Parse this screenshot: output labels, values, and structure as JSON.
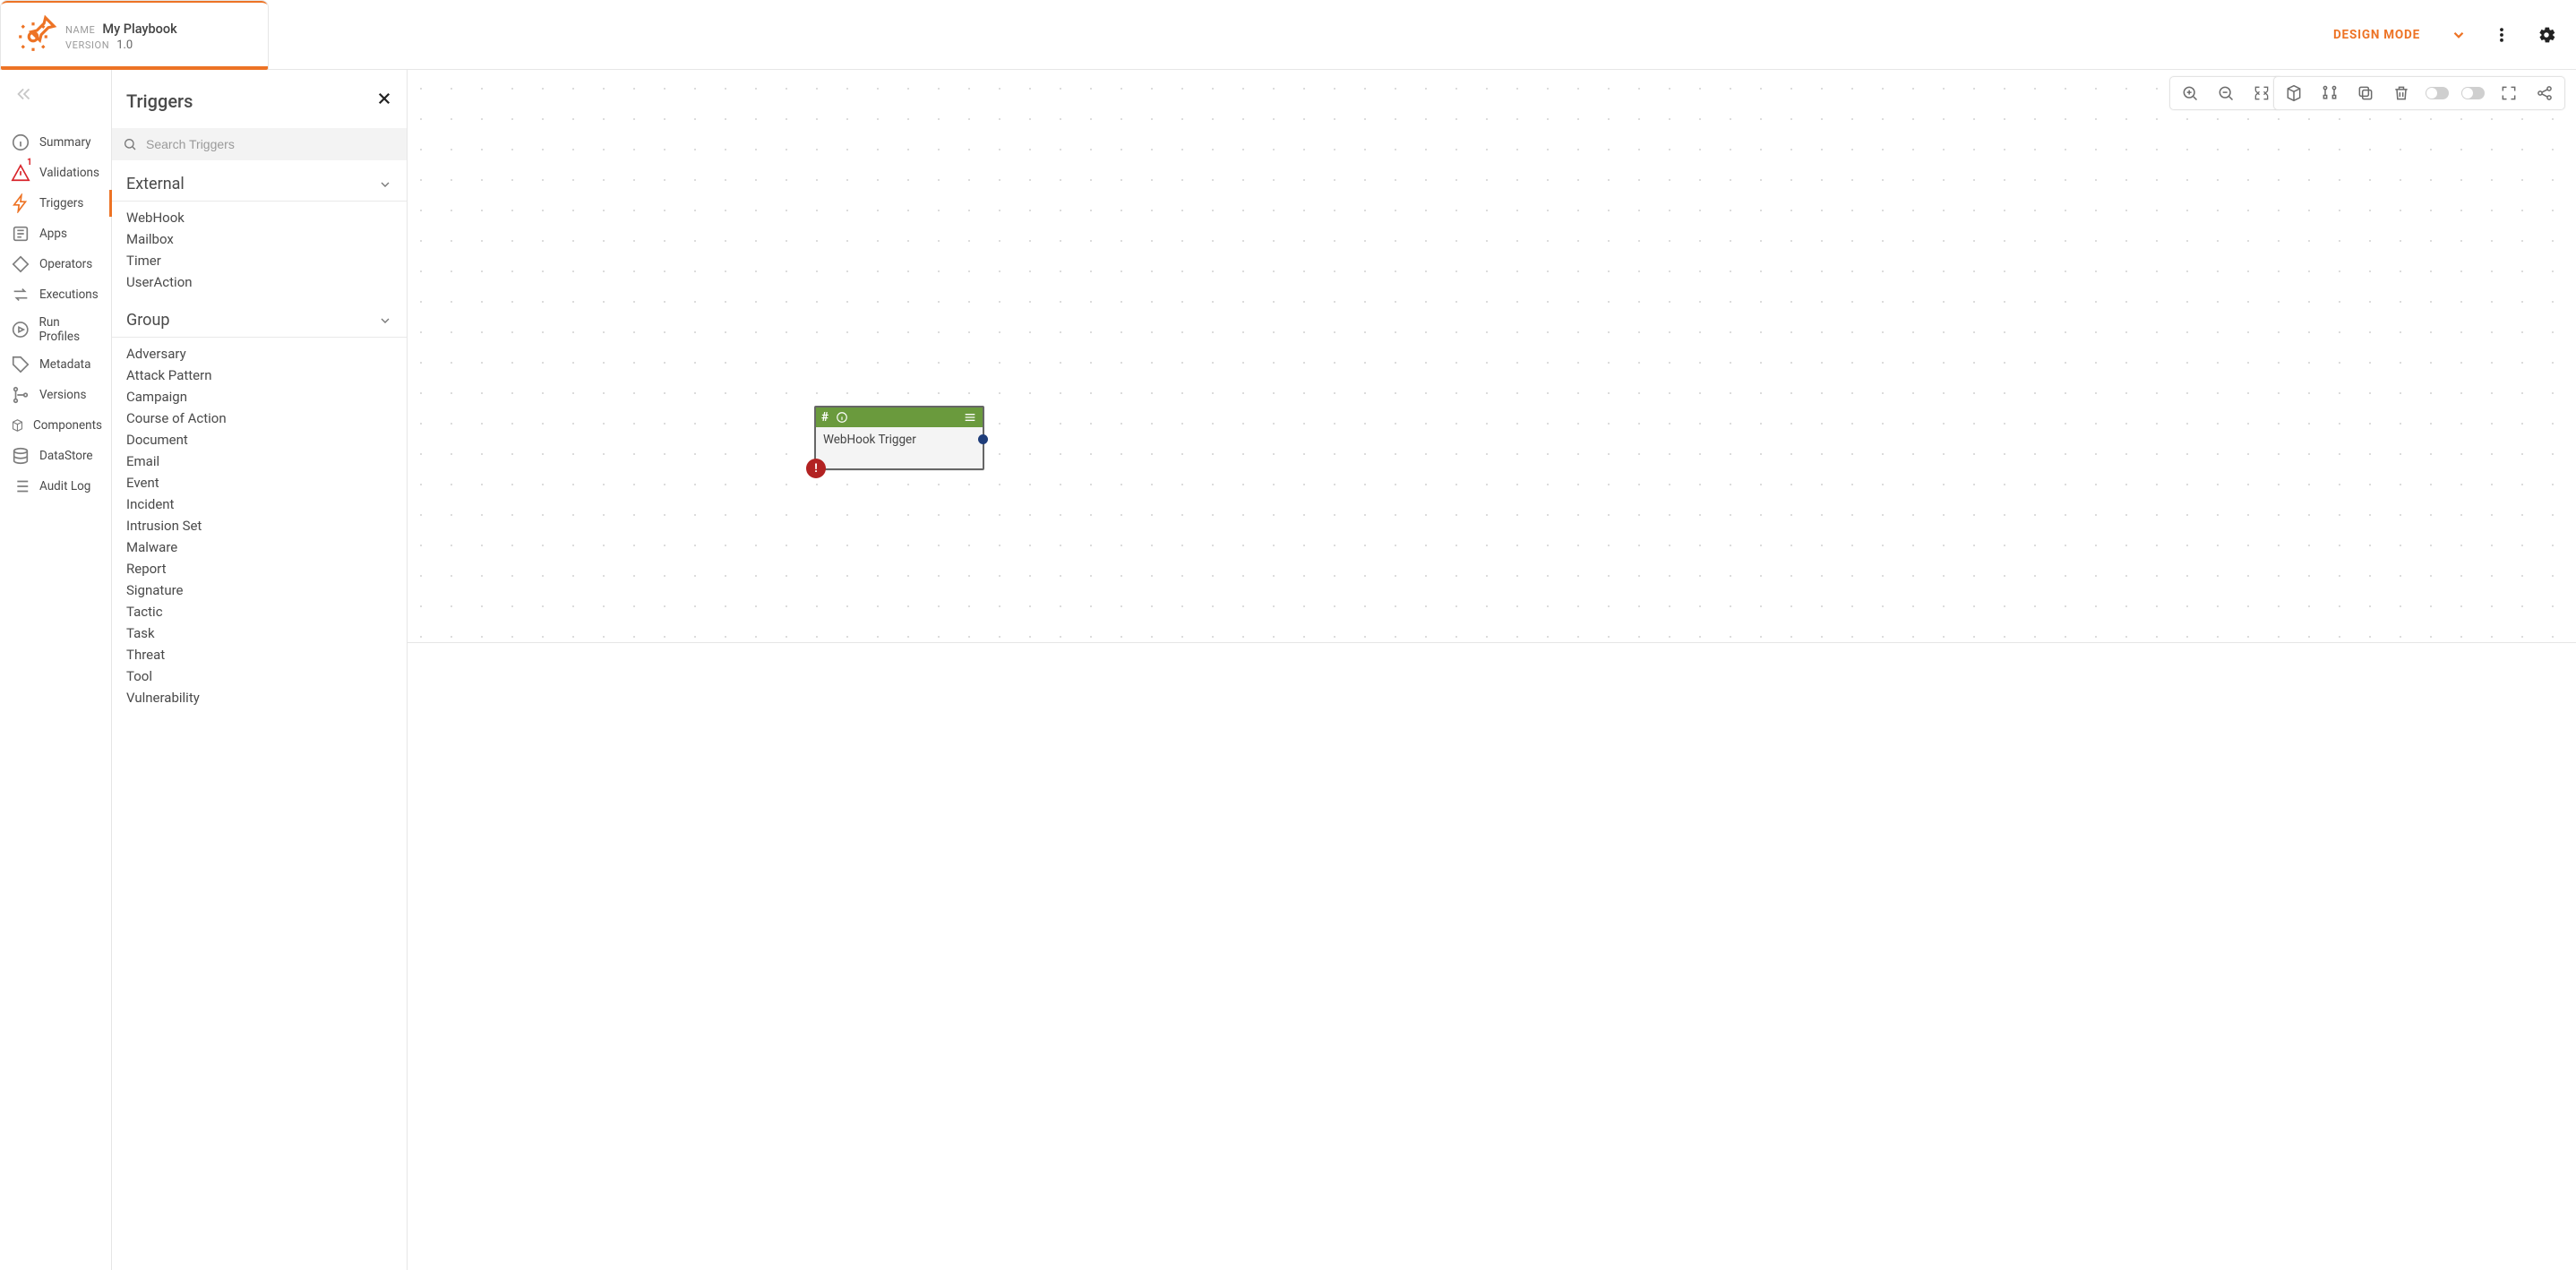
{
  "header": {
    "name_label": "NAME",
    "name_value": "My Playbook",
    "version_label": "VERSION",
    "version_value": "1.0",
    "mode_button": "DESIGN MODE"
  },
  "nav": {
    "items": [
      {
        "label": "Summary",
        "icon": "info-circle"
      },
      {
        "label": "Validations",
        "icon": "alert-triangle",
        "danger": true,
        "badge": "1"
      },
      {
        "label": "Triggers",
        "icon": "bolt",
        "active": true,
        "highlight": true
      },
      {
        "label": "Apps",
        "icon": "apps"
      },
      {
        "label": "Operators",
        "icon": "diamond"
      },
      {
        "label": "Executions",
        "icon": "swap"
      },
      {
        "label": "Run Profiles",
        "icon": "play-circle"
      },
      {
        "label": "Metadata",
        "icon": "tag"
      },
      {
        "label": "Versions",
        "icon": "branch"
      },
      {
        "label": "Components",
        "icon": "cube"
      },
      {
        "label": "DataStore",
        "icon": "database"
      },
      {
        "label": "Audit Log",
        "icon": "list"
      }
    ]
  },
  "panel": {
    "title": "Triggers",
    "search_placeholder": "Search Triggers",
    "groups": [
      {
        "title": "External",
        "items": [
          "WebHook",
          "Mailbox",
          "Timer",
          "UserAction"
        ]
      },
      {
        "title": "Group",
        "items": [
          "Adversary",
          "Attack Pattern",
          "Campaign",
          "Course of Action",
          "Document",
          "Email",
          "Event",
          "Incident",
          "Intrusion Set",
          "Malware",
          "Report",
          "Signature",
          "Tactic",
          "Task",
          "Threat",
          "Tool",
          "Vulnerability"
        ]
      }
    ]
  },
  "canvas": {
    "node": {
      "hash_icon": "#",
      "title": "WebHook Trigger",
      "error_badge": "!"
    }
  }
}
